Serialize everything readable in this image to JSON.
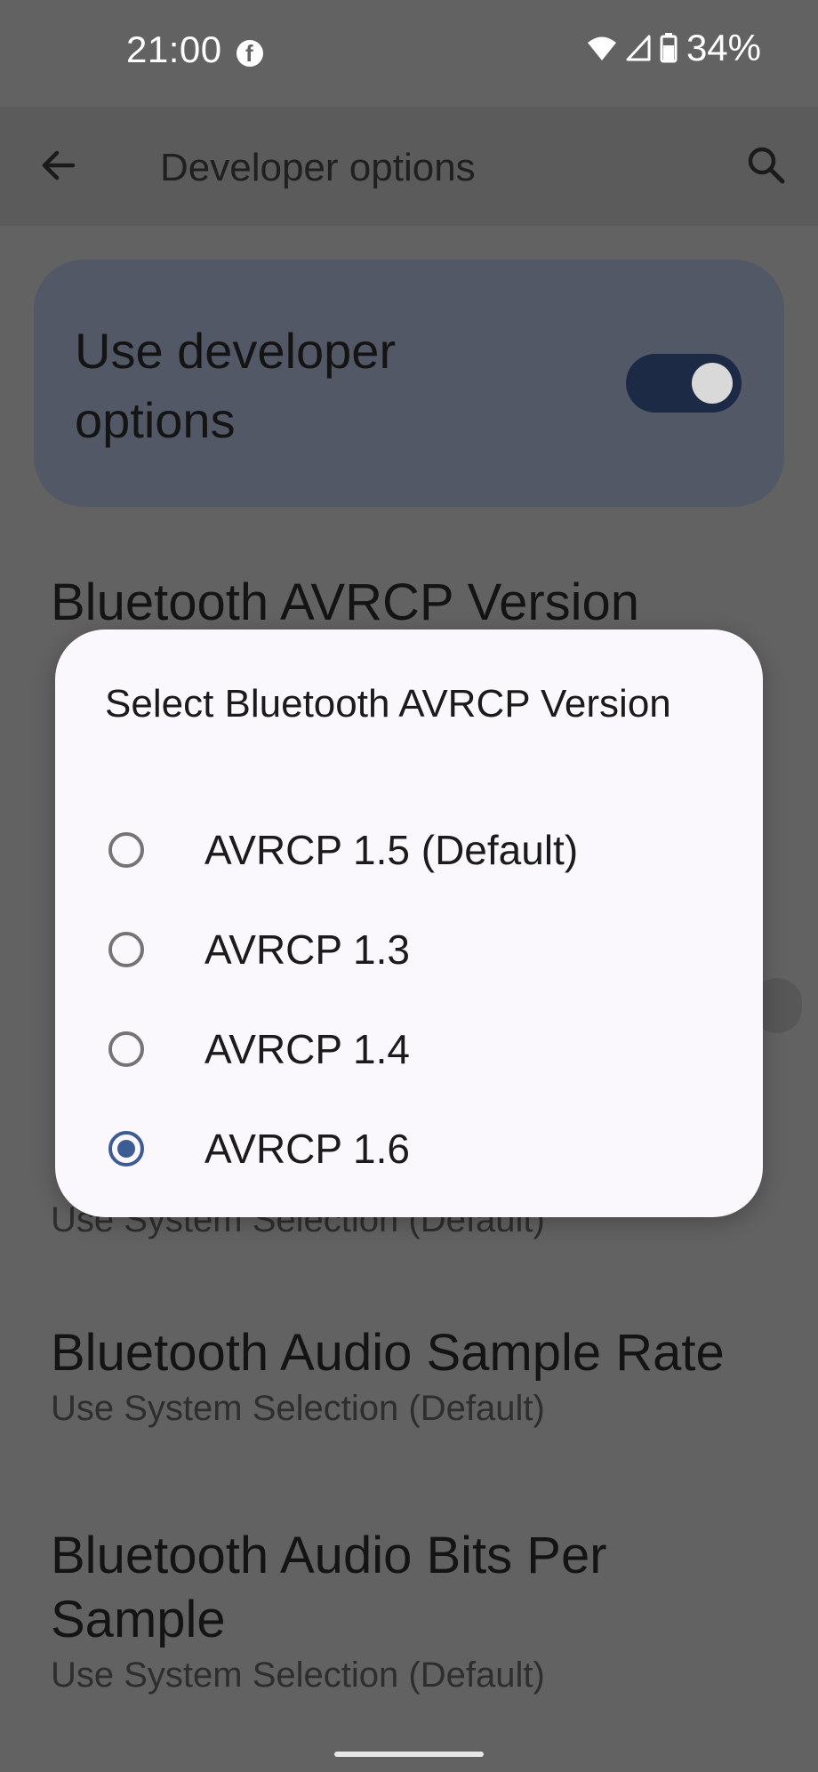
{
  "status_bar": {
    "time": "21:00",
    "notification_icon": "facebook-icon",
    "battery_percent": "34%",
    "icons": [
      "wifi-icon",
      "cell-signal-icon",
      "battery-icon"
    ]
  },
  "app_bar": {
    "title": "Developer options",
    "back_icon": "arrow-back-icon",
    "search_icon": "search-icon"
  },
  "master_toggle": {
    "label": "Use developer options",
    "state": "on"
  },
  "settings": [
    {
      "title": "Bluetooth AVRCP Version",
      "summary": ""
    },
    {
      "title": "",
      "summary": "Use System Selection (Default)"
    },
    {
      "title": "Bluetooth Audio Sample Rate",
      "summary": "Use System Selection (Default)"
    },
    {
      "title": "Bluetooth Audio Bits Per Sample",
      "summary": "Use System Selection (Default)"
    }
  ],
  "dialog": {
    "title": "Select Bluetooth AVRCP Version",
    "options": [
      {
        "label": "AVRCP 1.5 (Default)",
        "selected": false
      },
      {
        "label": "AVRCP 1.3",
        "selected": false
      },
      {
        "label": "AVRCP 1.4",
        "selected": false
      },
      {
        "label": "AVRCP 1.6",
        "selected": true
      }
    ]
  },
  "colors": {
    "scrim": "#626262",
    "dialog_bg": "#faf8fc",
    "accent": "#3d5c93",
    "toggle_track": "#1c2a45"
  }
}
